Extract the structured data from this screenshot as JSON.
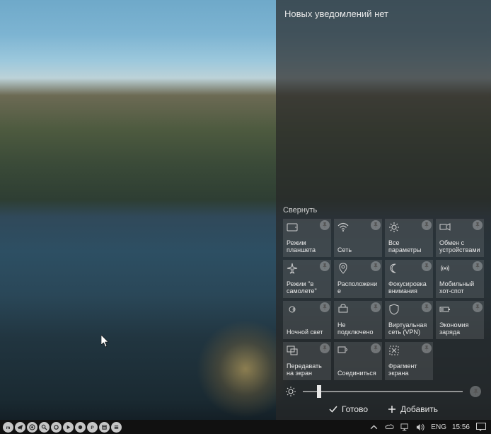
{
  "action_center": {
    "title": "Новых уведомлений нет",
    "collapse": "Свернуть",
    "tiles": [
      {
        "id": "tablet-mode",
        "label": "Режим планшета",
        "icon": "tablet"
      },
      {
        "id": "network",
        "label": "Сеть",
        "icon": "wifi"
      },
      {
        "id": "all-settings",
        "label": "Все параметры",
        "icon": "gear"
      },
      {
        "id": "share",
        "label": "Обмен с устройствами",
        "icon": "connect"
      },
      {
        "id": "airplane",
        "label": "Режим \"в самолете\"",
        "icon": "airplane"
      },
      {
        "id": "location",
        "label": "Расположение",
        "icon": "location"
      },
      {
        "id": "focus-assist",
        "label": "Фокусировка внимания",
        "icon": "moon"
      },
      {
        "id": "hotspot",
        "label": "Мобильный хот-спот",
        "icon": "hotspot"
      },
      {
        "id": "night-light",
        "label": "Ночной свет",
        "icon": "nightlight"
      },
      {
        "id": "vpn-status",
        "label": "Не подключено",
        "icon": "vpn"
      },
      {
        "id": "vpn",
        "label": "Виртуальная сеть (VPN)",
        "icon": "shield"
      },
      {
        "id": "battery-saver",
        "label": "Экономия заряда",
        "icon": "battery"
      },
      {
        "id": "project",
        "label": "Передавать на экран",
        "icon": "project"
      },
      {
        "id": "connect-dev",
        "label": "Соединиться",
        "icon": "connect2"
      },
      {
        "id": "snip",
        "label": "Фрагмент экрана",
        "icon": "snip"
      }
    ],
    "brightness_value": 10,
    "footer": {
      "done": "Готово",
      "add": "Добавить"
    }
  },
  "taskbar": {
    "apps": [
      {
        "id": "app1",
        "icon": "m"
      },
      {
        "id": "app2",
        "icon": "telegram"
      },
      {
        "id": "app3",
        "icon": "chrome"
      },
      {
        "id": "app4",
        "icon": "zoom"
      },
      {
        "id": "app5",
        "icon": "circle"
      },
      {
        "id": "app6",
        "icon": "play"
      },
      {
        "id": "app7",
        "icon": "record"
      },
      {
        "id": "app8",
        "icon": "p"
      },
      {
        "id": "app9",
        "icon": "film"
      },
      {
        "id": "app10",
        "icon": "bars"
      }
    ],
    "tray": {
      "lang": "ENG",
      "clock": "15:56"
    }
  }
}
